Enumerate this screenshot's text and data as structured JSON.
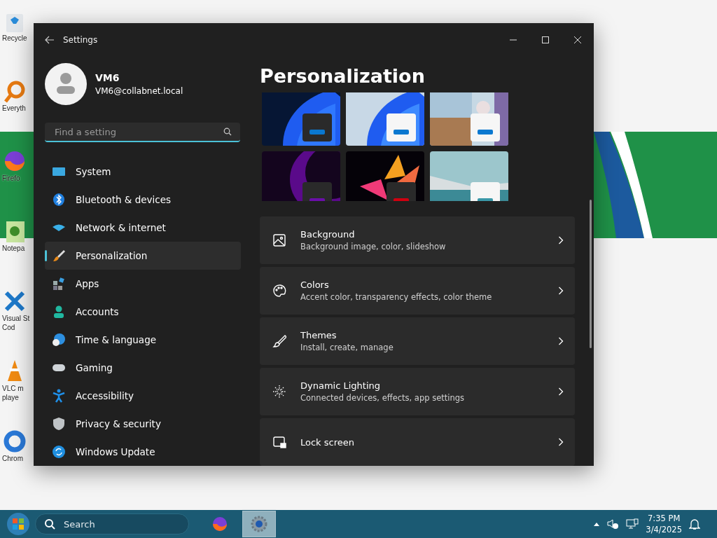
{
  "desktop": {
    "icons": [
      {
        "lines": [
          "Recycle"
        ]
      },
      {
        "lines": [
          "Everyth"
        ]
      },
      {
        "lines": [
          "Firefo"
        ]
      },
      {
        "lines": [
          "Notepa"
        ]
      },
      {
        "lines": [
          "Visual St",
          "Cod"
        ]
      },
      {
        "lines": [
          "VLC m",
          "playe"
        ]
      },
      {
        "lines": [
          "Chrom"
        ]
      }
    ]
  },
  "window": {
    "title": "Settings",
    "account": {
      "name": "VM6",
      "email": "VM6@collabnet.local"
    },
    "search": {
      "placeholder": "Find a setting"
    },
    "nav": [
      {
        "label": "System",
        "selected": false
      },
      {
        "label": "Bluetooth & devices",
        "selected": false
      },
      {
        "label": "Network & internet",
        "selected": false
      },
      {
        "label": "Personalization",
        "selected": true
      },
      {
        "label": "Apps",
        "selected": false
      },
      {
        "label": "Accounts",
        "selected": false
      },
      {
        "label": "Time & language",
        "selected": false
      },
      {
        "label": "Gaming",
        "selected": false
      },
      {
        "label": "Accessibility",
        "selected": false
      },
      {
        "label": "Privacy & security",
        "selected": false
      },
      {
        "label": "Windows Update",
        "selected": false
      }
    ],
    "page_title": "Personalization",
    "themes": [
      {
        "kind": "dark",
        "color": "#0a78d0"
      },
      {
        "kind": "light",
        "color": "#0a78d0"
      },
      {
        "kind": "light",
        "color": "#0a78d0"
      },
      {
        "kind": "dark",
        "color": "#6a0fa8"
      },
      {
        "kind": "dark",
        "color": "#d00010"
      },
      {
        "kind": "light",
        "color": "#3a98a8"
      }
    ],
    "cards": [
      {
        "title": "Background",
        "subtitle": "Background image, color, slideshow"
      },
      {
        "title": "Colors",
        "subtitle": "Accent color, transparency effects, color theme"
      },
      {
        "title": "Themes",
        "subtitle": "Install, create, manage"
      },
      {
        "title": "Dynamic Lighting",
        "subtitle": "Connected devices, effects, app settings"
      },
      {
        "title": "Lock screen"
      }
    ]
  },
  "taskbar": {
    "search": {
      "placeholder": "Search"
    },
    "apps": [
      {
        "kind": "browser",
        "selected": false
      },
      {
        "kind": "settings",
        "selected": true
      }
    ],
    "time": "7:35 PM",
    "date": "3/4/2025"
  }
}
